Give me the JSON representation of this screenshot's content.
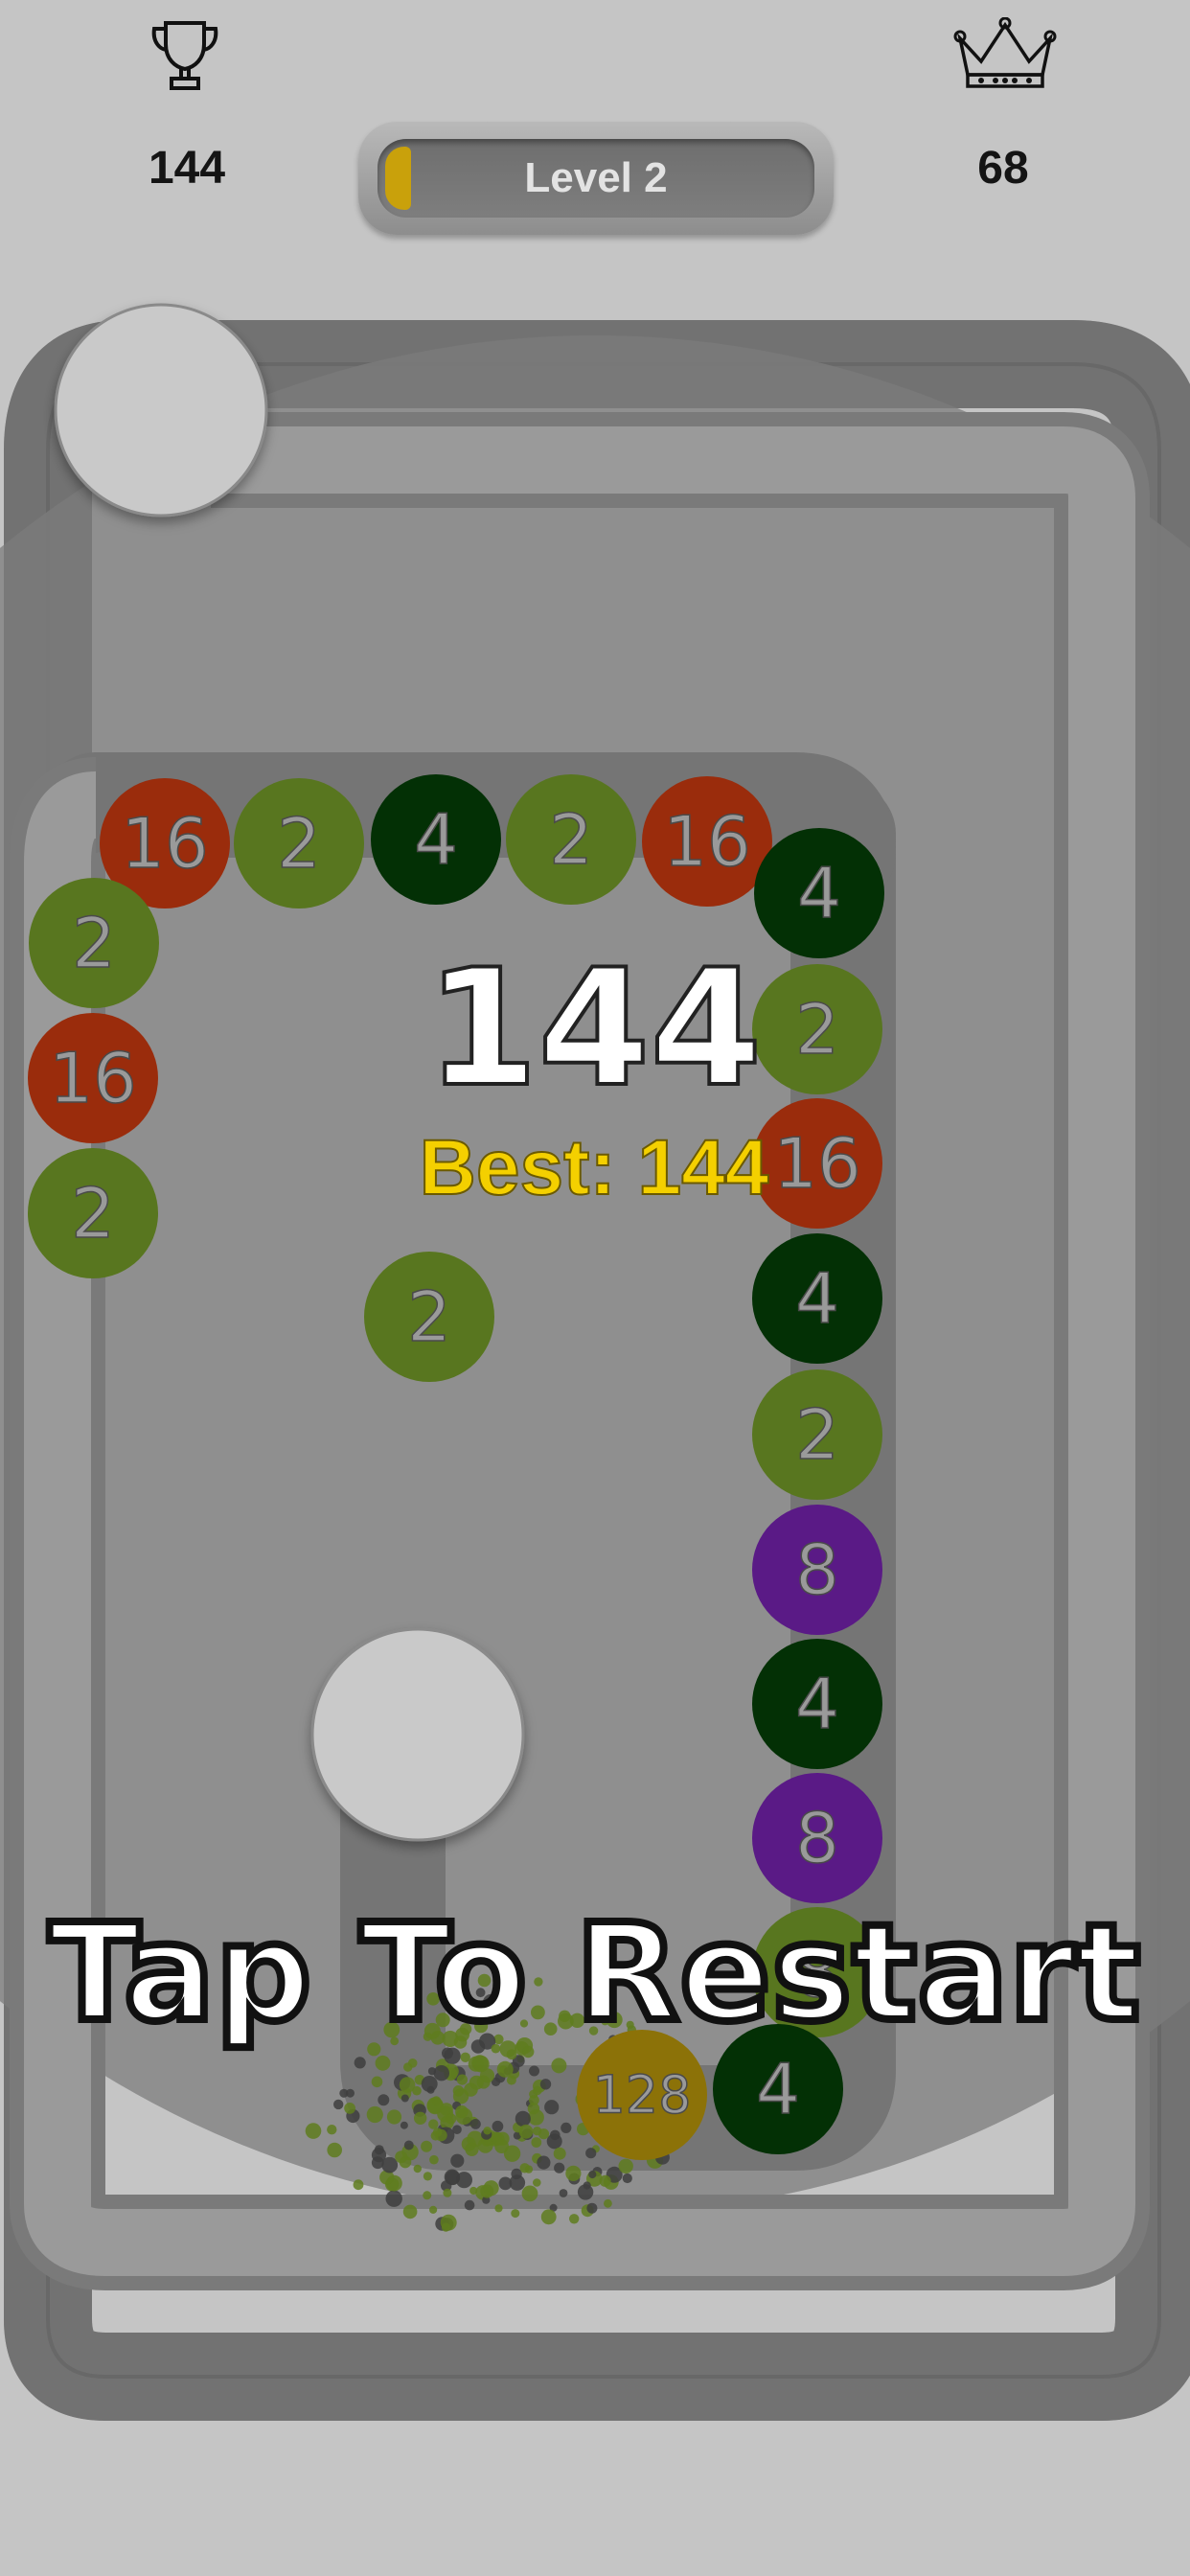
{
  "hud": {
    "high_score": "144",
    "level_label": "Level 2",
    "level_progress": 0.06,
    "crown_value": "68",
    "trophy_icon": "trophy-icon",
    "crown_icon": "crown-icon"
  },
  "game": {
    "score": "144",
    "best_label": "Best: 144",
    "restart_prompt": "Tap To Restart",
    "shooter_ball": {
      "value": "2",
      "color": "#58761f"
    },
    "chain": [
      {
        "value": "16",
        "color": "#9a2c0c"
      },
      {
        "value": "2",
        "color": "#58761f"
      },
      {
        "value": "4",
        "color": "#033005"
      },
      {
        "value": "2",
        "color": "#58761f"
      },
      {
        "value": "16",
        "color": "#9a2c0c"
      },
      {
        "value": "4",
        "color": "#033005"
      },
      {
        "value": "2",
        "color": "#58761f"
      },
      {
        "value": "16",
        "color": "#9a2c0c"
      },
      {
        "value": "4",
        "color": "#033005"
      },
      {
        "value": "2",
        "color": "#58761f"
      },
      {
        "value": "8",
        "color": "#5a1a86"
      },
      {
        "value": "4",
        "color": "#033005"
      },
      {
        "value": "8",
        "color": "#5a1a86"
      },
      {
        "value": "8",
        "color": "#58761f"
      },
      {
        "value": "4",
        "color": "#033005"
      },
      {
        "value": "128",
        "color": "#8c7208"
      },
      {
        "value": "2",
        "color": "#58761f"
      },
      {
        "value": "16",
        "color": "#9a2c0c"
      },
      {
        "value": "2",
        "color": "#58761f"
      }
    ]
  },
  "colors": {
    "background": "#c5c5c5",
    "overlay": "#8a8a8a",
    "best_text": "#f4d000",
    "level_fill": "#c9a10b"
  }
}
